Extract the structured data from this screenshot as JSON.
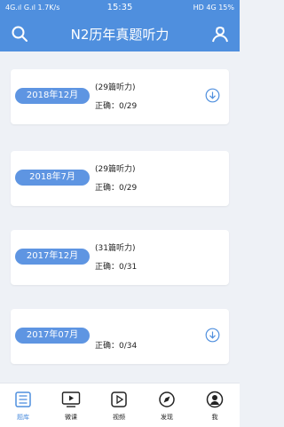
{
  "status_bar": {
    "left": "4G.ıl G.ıl 1.7K/s",
    "time": "15:35",
    "right": "HD 4G 15%"
  },
  "header": {
    "title": "N2历年真题听力",
    "search_icon": "search-icon",
    "profile_icon": "person-icon"
  },
  "cards": [
    {
      "date": "2018年12月",
      "count": "(29篇听力)",
      "correct": "正确：0/29",
      "download": true
    },
    {
      "date": "2018年7月",
      "count": "(29篇听力)",
      "correct": "正确：0/29",
      "download": false
    },
    {
      "date": "2017年12月",
      "count": "(31篇听力)",
      "correct": "正确：0/31",
      "download": false
    },
    {
      "date": "2017年07月",
      "count": "",
      "correct": "正确：0/34",
      "download": true
    }
  ],
  "nav": {
    "items": [
      {
        "label": "题库",
        "icon": "list-icon"
      },
      {
        "label": "微课",
        "icon": "video-icon"
      },
      {
        "label": "视频",
        "icon": "play-icon"
      },
      {
        "label": "发现",
        "icon": "compass-icon"
      },
      {
        "label": "我",
        "icon": "user-icon"
      }
    ]
  },
  "colors": {
    "accent": "#4f8fde",
    "pill": "#5e95e2"
  }
}
